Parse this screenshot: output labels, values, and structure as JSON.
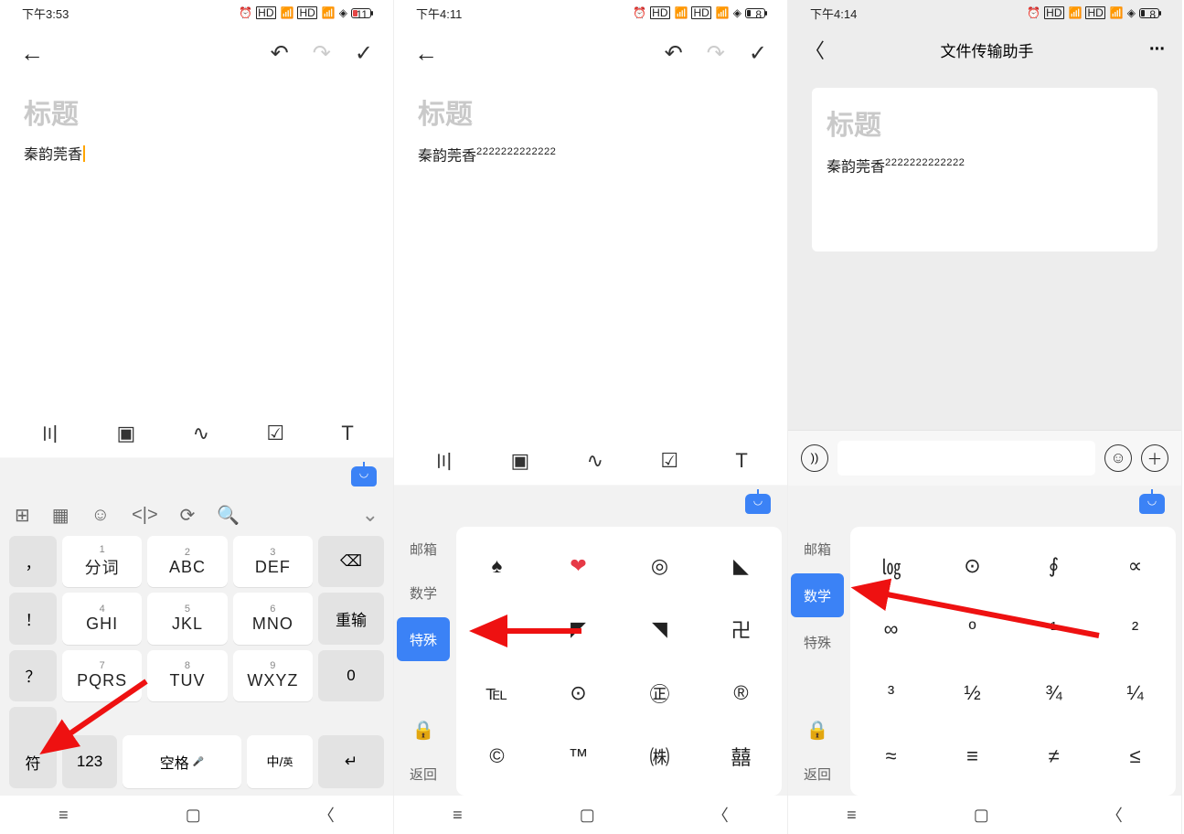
{
  "screens": {
    "s1": {
      "time": "下午3:53",
      "battery": "11",
      "title_placeholder": "标题",
      "body_text": "秦韵莞香",
      "format_icons": [
        "〣",
        "▢",
        "∿",
        "☑",
        "T"
      ],
      "kb_tools": [
        "⊞",
        "⊟",
        "☺",
        "<|>",
        "⟳",
        "🔍"
      ],
      "keys": {
        "side": [
          "，",
          "！",
          "？",
          "."
        ],
        "r1": [
          {
            "n": "1",
            "l": "分词"
          },
          {
            "n": "2",
            "l": "ABC"
          },
          {
            "n": "3",
            "l": "DEF"
          }
        ],
        "r2": [
          {
            "n": "4",
            "l": "GHI"
          },
          {
            "n": "5",
            "l": "JKL"
          },
          {
            "n": "6",
            "l": "MNO"
          }
        ],
        "r3": [
          {
            "n": "7",
            "l": "PQRS"
          },
          {
            "n": "8",
            "l": "TUV"
          },
          {
            "n": "9",
            "l": "WXYZ"
          }
        ],
        "right": [
          "⌫",
          "重输",
          "0",
          "↵"
        ],
        "bottom": {
          "sym": "符",
          "num": "123",
          "space": "空格",
          "mic": "🎤",
          "lang1": "中",
          "lang2": "英"
        }
      }
    },
    "s2": {
      "time": "下午4:11",
      "battery": "8",
      "title_placeholder": "标题",
      "body_text": "秦韵莞香",
      "body_sup": "2222222222222",
      "cats": [
        "邮箱",
        "数学",
        "特殊",
        "",
        "🔒",
        "返回"
      ],
      "active_cat": 2,
      "symbols": [
        "♠",
        "❤",
        "◎",
        "◣",
        "◤",
        "◤",
        "◥",
        "卍",
        "℡",
        "⊙",
        "㊣",
        "®",
        "©",
        "™",
        "㈱",
        "囍"
      ]
    },
    "s3": {
      "time": "下午4:14",
      "battery": "8",
      "wx_title": "文件传输助手",
      "title_placeholder": "标题",
      "body_text": "秦韵莞香",
      "body_sup": "2222222222222",
      "cats": [
        "邮箱",
        "数学",
        "特殊",
        "",
        "🔒",
        "返回"
      ],
      "active_cat": 1,
      "symbols": [
        "㏒",
        "⊙",
        "∮",
        "∝",
        "∞",
        "º",
        "¹",
        "²",
        "³",
        "½",
        "¾",
        "¼",
        "≈",
        "≡",
        "≠",
        "≤"
      ]
    }
  }
}
